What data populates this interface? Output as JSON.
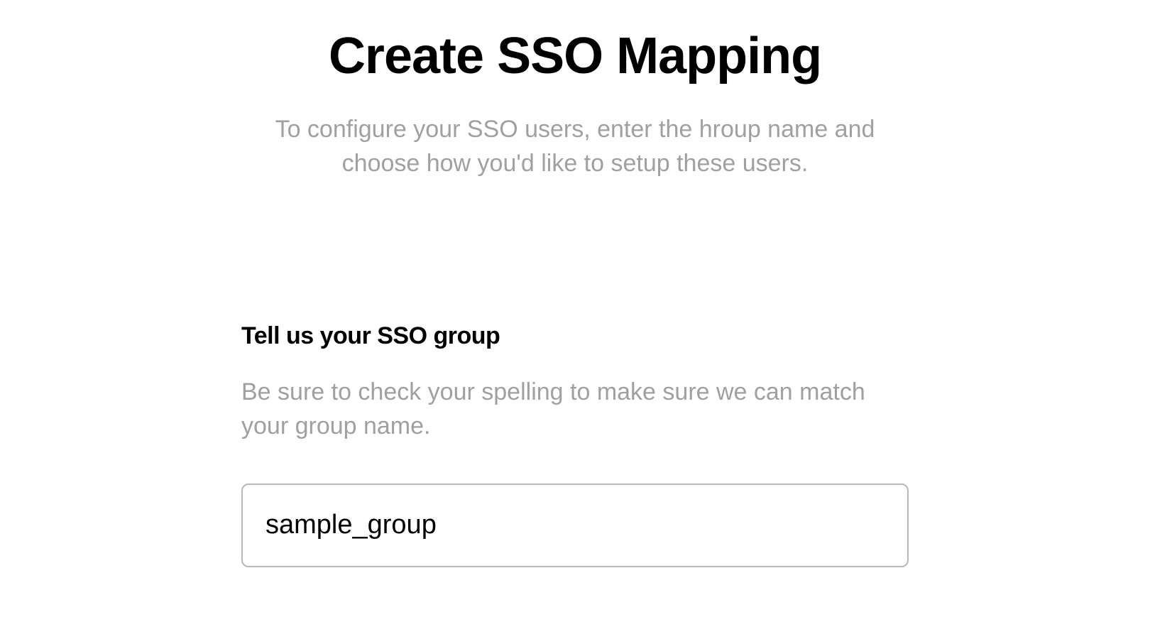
{
  "header": {
    "title": "Create SSO Mapping",
    "subtitle": "To configure your SSO users, enter the hroup name and choose how you'd like to setup these users."
  },
  "form": {
    "group_section": {
      "title": "Tell us your SSO group",
      "description": "Be sure to check your spelling to make sure we can match your group name.",
      "input_value": "sample_group",
      "input_placeholder": ""
    }
  }
}
